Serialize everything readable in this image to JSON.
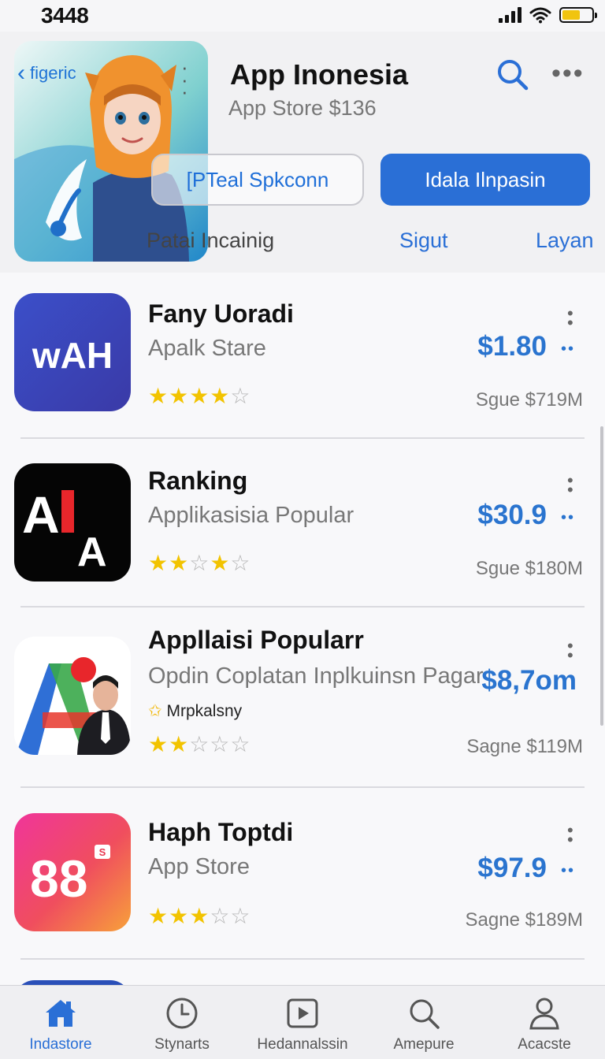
{
  "status_bar": {
    "time": "3448"
  },
  "header": {
    "back_label": "figeric",
    "title": "App Inonesia",
    "subtitle": "App Store  $136",
    "secondary_button": "[PTeal Spkconn",
    "primary_button": "Idala Ilnpasin",
    "sub_tabs": [
      "Patai Incainig",
      "Sigut",
      "Layan"
    ]
  },
  "colors": {
    "accent": "#2a6fd6",
    "star": "#f2c300",
    "price": "#2a74cf"
  },
  "apps": [
    {
      "name": "Fany Uoradi",
      "subtitle": "Apalk Stare",
      "price": "$1.80",
      "rating": 4,
      "stars": "★★★★☆",
      "size": "Sgue  $719M",
      "icon_text": "wAH",
      "icon": "wah-app-icon"
    },
    {
      "name": "Ranking",
      "subtitle": "Applikasisia Popular",
      "price": "$30.9",
      "rating": 3,
      "stars": "★★☆★☆",
      "size": "Sgue  $180M",
      "icon_text": "AI A",
      "icon": "ai-app-icon"
    },
    {
      "name": "Appllaisi Popularr",
      "subtitle": "Opdin Coplatan Inplkuinsn Pagar",
      "extra": "Mrpkalsny",
      "price": "$8,7om",
      "rating": 2,
      "stars": "★★☆☆☆",
      "size": "Sagne  $119M",
      "icon": "a-plus-app-icon"
    },
    {
      "name": "Haph Toptdi",
      "subtitle": "App Store",
      "price": "$97.9",
      "rating": 3,
      "stars": "★★★☆☆",
      "size": "Sagne  $189M",
      "icon_text": "88",
      "icon_badge": "S",
      "icon": "eighty-eight-app-icon"
    }
  ],
  "tab_bar": [
    {
      "label": "Indastore",
      "icon": "home-icon",
      "active": true
    },
    {
      "label": "Stynarts",
      "icon": "clock-icon",
      "active": false
    },
    {
      "label": "Hedannalssin",
      "icon": "play-icon",
      "active": false
    },
    {
      "label": "Amepure",
      "icon": "search-icon",
      "active": false
    },
    {
      "label": "Acacste",
      "icon": "person-icon",
      "active": false
    }
  ]
}
